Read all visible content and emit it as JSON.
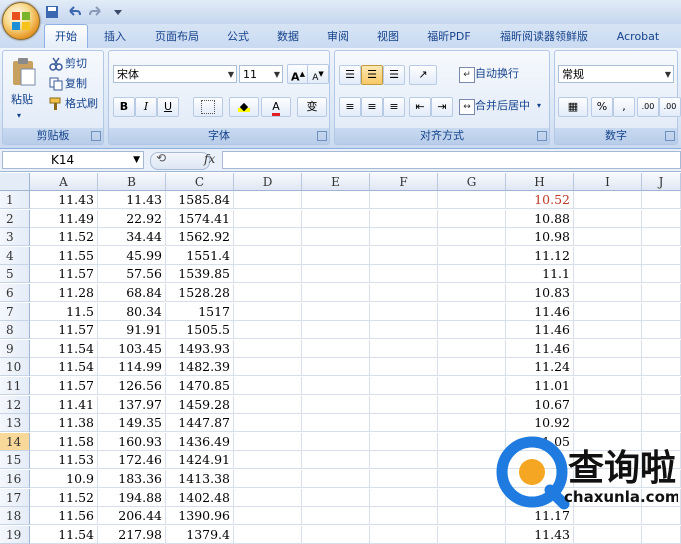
{
  "tabs": [
    "开始",
    "插入",
    "页面布局",
    "公式",
    "数据",
    "审阅",
    "视图",
    "福昕PDF",
    "福昕阅读器领鲜版",
    "Acrobat"
  ],
  "active_tab": 0,
  "clipboard": {
    "paste": "粘贴",
    "cut": "剪切",
    "copy": "复制",
    "format_painter": "格式刷",
    "label": "剪贴板"
  },
  "font": {
    "name": "宋体",
    "size": "11",
    "bold": "B",
    "italic": "I",
    "underline": "U",
    "font_color_glyph": "A",
    "phonetic": "变",
    "grow": "A",
    "shrink": "A",
    "label": "字体"
  },
  "alignment": {
    "wrap": "自动换行",
    "merge": "合并后居中",
    "label": "对齐方式"
  },
  "number": {
    "format": "常规",
    "percent": "%",
    "comma": ",",
    "inc_decimal": ".00",
    "dec_decimal": ".00",
    "label": "数字"
  },
  "name_box": "K14",
  "fx": "fx",
  "columns": [
    "A",
    "B",
    "C",
    "D",
    "E",
    "F",
    "G",
    "H",
    "I",
    "J"
  ],
  "rows": [
    {
      "n": "1",
      "a": "11.43",
      "b": "11.43",
      "c": "1585.84",
      "h": "10.52"
    },
    {
      "n": "2",
      "a": "11.49",
      "b": "22.92",
      "c": "1574.41",
      "h": "10.88"
    },
    {
      "n": "3",
      "a": "11.52",
      "b": "34.44",
      "c": "1562.92",
      "h": "10.98"
    },
    {
      "n": "4",
      "a": "11.55",
      "b": "45.99",
      "c": "1551.4",
      "h": "11.12"
    },
    {
      "n": "5",
      "a": "11.57",
      "b": "57.56",
      "c": "1539.85",
      "h": "11.1"
    },
    {
      "n": "6",
      "a": "11.28",
      "b": "68.84",
      "c": "1528.28",
      "h": "10.83"
    },
    {
      "n": "7",
      "a": "11.5",
      "b": "80.34",
      "c": "1517",
      "h": "11.46"
    },
    {
      "n": "8",
      "a": "11.57",
      "b": "91.91",
      "c": "1505.5",
      "h": "11.46"
    },
    {
      "n": "9",
      "a": "11.54",
      "b": "103.45",
      "c": "1493.93",
      "h": "11.46"
    },
    {
      "n": "10",
      "a": "11.54",
      "b": "114.99",
      "c": "1482.39",
      "h": "11.24"
    },
    {
      "n": "11",
      "a": "11.57",
      "b": "126.56",
      "c": "1470.85",
      "h": "11.01"
    },
    {
      "n": "12",
      "a": "11.41",
      "b": "137.97",
      "c": "1459.28",
      "h": "10.67"
    },
    {
      "n": "13",
      "a": "11.38",
      "b": "149.35",
      "c": "1447.87",
      "h": "10.92"
    },
    {
      "n": "14",
      "a": "11.58",
      "b": "160.93",
      "c": "1436.49",
      "h": "11.05"
    },
    {
      "n": "15",
      "a": "11.53",
      "b": "172.46",
      "c": "1424.91",
      "h": ""
    },
    {
      "n": "16",
      "a": "10.9",
      "b": "183.36",
      "c": "1413.38",
      "h": ""
    },
    {
      "n": "17",
      "a": "11.52",
      "b": "194.88",
      "c": "1402.48",
      "h": ""
    },
    {
      "n": "18",
      "a": "11.56",
      "b": "206.44",
      "c": "1390.96",
      "h": "11.17"
    },
    {
      "n": "19",
      "a": "11.54",
      "b": "217.98",
      "c": "1379.4",
      "h": "11.43"
    }
  ],
  "watermark": {
    "brand": "查询啦",
    "url": "chaxunla.com"
  }
}
